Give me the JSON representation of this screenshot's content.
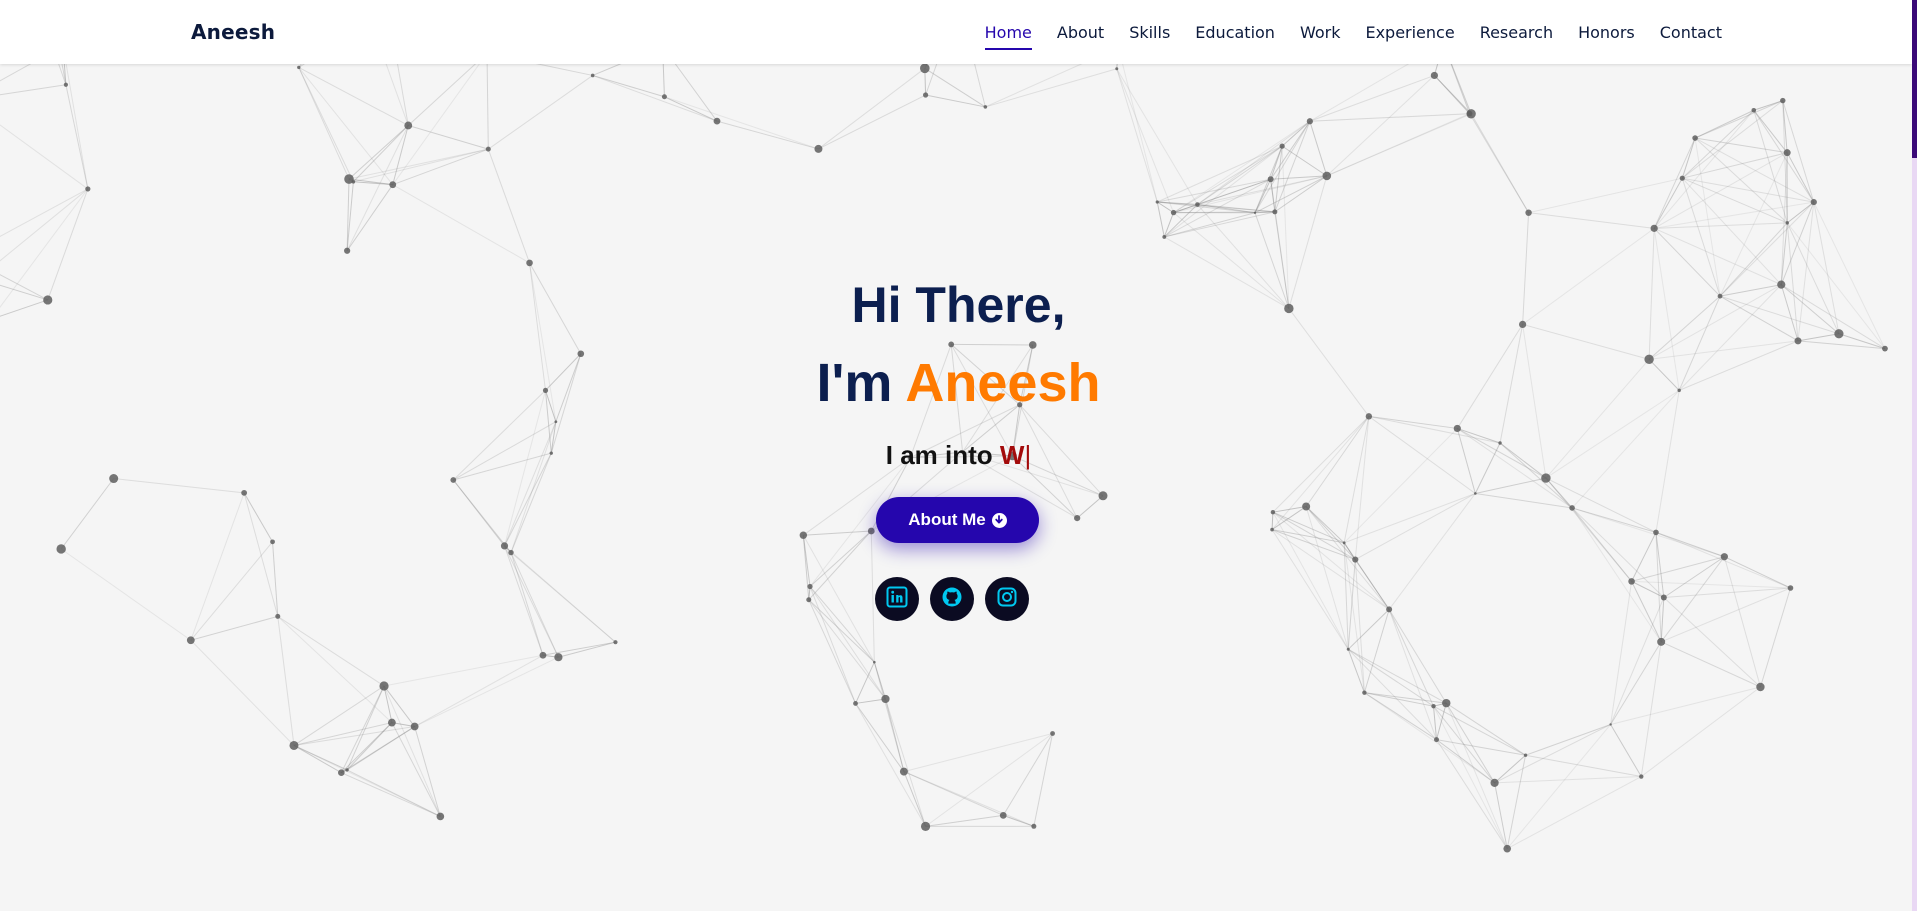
{
  "brand": "Aneesh",
  "nav": {
    "items": [
      "Home",
      "About",
      "Skills",
      "Education",
      "Work",
      "Experience",
      "Research",
      "Honors",
      "Contact"
    ],
    "active": "Home"
  },
  "hero": {
    "line1": "Hi There,",
    "line2_prefix": "I'm",
    "line2_name": "Aneesh",
    "typed_prefix": "I am into",
    "typed_text": "W",
    "caret": "|",
    "button_label": "About Me"
  },
  "socials": [
    {
      "name": "linkedin",
      "icon": "linkedin-icon"
    },
    {
      "name": "github",
      "icon": "github-icon"
    },
    {
      "name": "instagram",
      "icon": "instagram-icon"
    }
  ],
  "colors": {
    "accent": "#2506ad",
    "name": "#ff7a00",
    "heading": "#0c1f4f",
    "typed": "#a30b0b",
    "social_bg": "#0b0b22",
    "social_icon": "#00c8f0"
  }
}
